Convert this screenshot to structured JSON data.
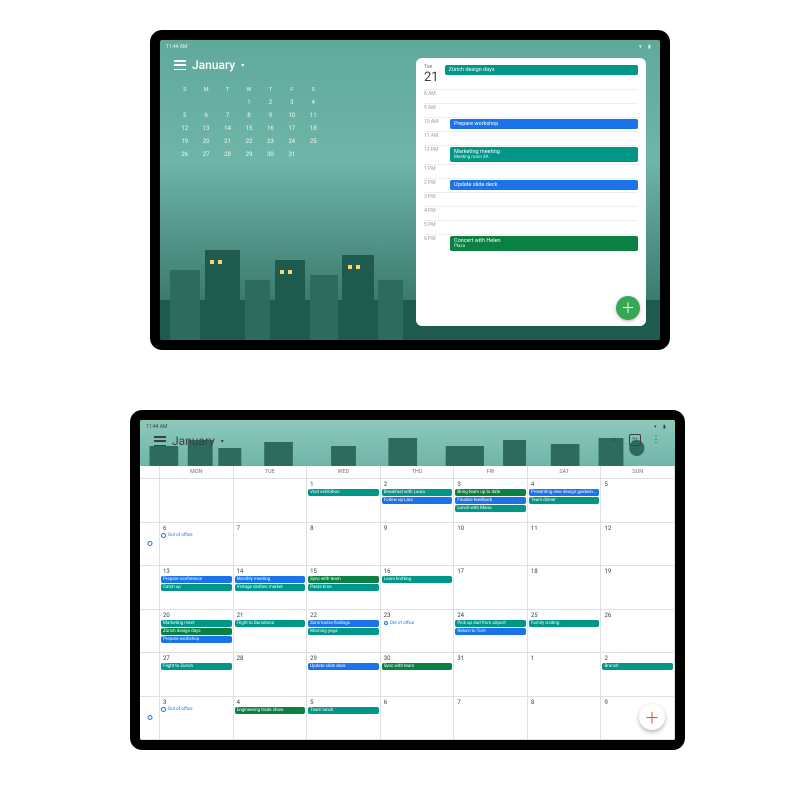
{
  "status": {
    "time": "11:44 AM"
  },
  "colors": {
    "blue": "#1a73e8",
    "teal": "#009688",
    "green": "#0b8043"
  },
  "t1": {
    "month_title": "January",
    "today_chip": "21",
    "dow": [
      "S",
      "M",
      "T",
      "W",
      "T",
      "F",
      "S"
    ],
    "weeks": [
      [
        "",
        "",
        "",
        "1",
        "2",
        "3",
        "4"
      ],
      [
        "5",
        "6",
        "7",
        "8",
        "9",
        "10",
        "11"
      ],
      [
        "12",
        "13",
        "14",
        "15",
        "16",
        "17",
        "18"
      ],
      [
        "19",
        "20",
        "21",
        "22",
        "23",
        "24",
        "25"
      ],
      [
        "26",
        "27",
        "28",
        "29",
        "30",
        "31",
        ""
      ]
    ],
    "selected_day": "21",
    "agenda": {
      "dow": "Tue",
      "date": "21",
      "allday": "Zürich design days",
      "slots": [
        {
          "time": "8 AM",
          "events": []
        },
        {
          "time": "9 AM",
          "events": []
        },
        {
          "time": "10 AM",
          "events": [
            {
              "title": "Prepare workshop",
              "color": "blue"
            }
          ]
        },
        {
          "time": "11 AM",
          "events": []
        },
        {
          "time": "12 PM",
          "events": [
            {
              "title": "Marketing meeting",
              "sub": "Meeting room 4A",
              "color": "teal"
            }
          ]
        },
        {
          "time": "1 PM",
          "events": []
        },
        {
          "time": "2 PM",
          "events": [
            {
              "title": "Update slide deck",
              "color": "blue"
            }
          ]
        },
        {
          "time": "3 PM",
          "events": []
        },
        {
          "time": "4 PM",
          "events": []
        },
        {
          "time": "5 PM",
          "events": []
        },
        {
          "time": "6 PM",
          "events": [
            {
              "title": "Concert with Helen",
              "sub": "Plaza",
              "color": "green"
            }
          ]
        }
      ]
    }
  },
  "t2": {
    "month_title": "January",
    "today_chip": "21",
    "dow": [
      "",
      "MON",
      "TUE",
      "WED",
      "THU",
      "FRI",
      "SAT",
      "SUN"
    ],
    "weeks": [
      {
        "days": [
          "",
          "",
          "1",
          "2",
          "3",
          "4",
          "5"
        ],
        "events": {
          "2": [
            {
              "t": "Breakfast with Laura",
              "c": "teal"
            },
            {
              "t": "Follow up Lars",
              "c": "blue"
            }
          ],
          "3": [
            {
              "t": "Bring team up to date",
              "c": "green"
            },
            {
              "t": "Finalize feedback",
              "c": "blue"
            },
            {
              "t": "Lunch with Maria",
              "c": "teal"
            }
          ],
          "4": [
            {
              "t": "Presenting new design guidelines",
              "c": "blue"
            },
            {
              "t": "Team dinner",
              "c": "teal"
            }
          ],
          "5": [],
          "1": [
            {
              "t": "Visit exhibition",
              "c": "teal"
            }
          ]
        },
        "oob": false
      },
      {
        "days": [
          "6",
          "7",
          "8",
          "9",
          "10",
          "11",
          "12"
        ],
        "events": {
          "6": [],
          "7": [],
          "8": [],
          "9": [],
          "10": [],
          "11": [],
          "12": []
        },
        "oob": true,
        "oob_label": "Out of office"
      },
      {
        "days": [
          "13",
          "14",
          "15",
          "16",
          "17",
          "18",
          "19"
        ],
        "events": {
          "13": [
            {
              "t": "Prepare conference",
              "c": "blue"
            },
            {
              "t": "Catch up",
              "c": "teal"
            }
          ],
          "14": [
            {
              "t": "Monthly meeting",
              "c": "blue"
            },
            {
              "t": "Vintage clothes market",
              "c": "teal"
            }
          ],
          "15": [
            {
              "t": "Sync with team",
              "c": "green"
            },
            {
              "t": "Pasta time",
              "c": "teal"
            }
          ],
          "16": [
            {
              "t": "Learn knitting",
              "c": "teal"
            }
          ],
          "17": [],
          "18": [],
          "19": []
        },
        "oob": false
      },
      {
        "days": [
          "20",
          "21",
          "22",
          "23",
          "24",
          "25",
          "26"
        ],
        "events": {
          "20": [
            {
              "t": "Marketing meet",
              "c": "teal"
            },
            {
              "t": "Zürich design days",
              "c": "green"
            },
            {
              "t": "Prepare workshop",
              "c": "blue"
            }
          ],
          "21": [
            {
              "t": "Flight to Barcelona",
              "c": "teal"
            }
          ],
          "22": [
            {
              "t": "Summarize findings",
              "c": "blue"
            },
            {
              "t": "Morning yoga",
              "c": "teal"
            }
          ],
          "23": [
            {
              "t": "Out of office",
              "c": "outline"
            }
          ],
          "24": [
            {
              "t": "Pick up dad from airport",
              "c": "teal"
            },
            {
              "t": "Return to Tom",
              "c": "blue"
            }
          ],
          "25": [
            {
              "t": "Family visiting",
              "c": "teal"
            }
          ],
          "26": []
        },
        "oob": false
      },
      {
        "days": [
          "27",
          "28",
          "29",
          "30",
          "31",
          "1",
          "2"
        ],
        "events": {
          "27": [
            {
              "t": "Flight to Zürich",
              "c": "teal"
            }
          ],
          "28": [],
          "29": [
            {
              "t": "Update slide deck",
              "c": "blue"
            }
          ],
          "30": [
            {
              "t": "Sync with team",
              "c": "green"
            }
          ],
          "31": [],
          "1": [],
          "2": [
            {
              "t": "Brunch",
              "c": "teal"
            }
          ]
        },
        "oob": false
      },
      {
        "days": [
          "3",
          "4",
          "5",
          "6",
          "7",
          "8",
          "9"
        ],
        "events": {
          "4": [
            {
              "t": "Engineering trade show",
              "c": "green"
            }
          ],
          "5": [
            {
              "t": "Team lunch",
              "c": "teal"
            }
          ],
          "3": [],
          "6": [],
          "7": [],
          "8": [],
          "9": []
        },
        "oob": true,
        "oob_label": "Out of office"
      }
    ]
  }
}
